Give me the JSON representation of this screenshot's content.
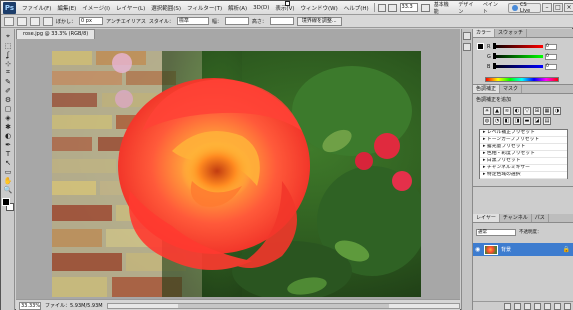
{
  "menubar": {
    "logo": "Ps",
    "items": [
      "ファイル(F)",
      "編集(E)",
      "イメージ(I)",
      "レイヤー(L)",
      "選択範囲(S)",
      "フィルター(T)",
      "解析(A)",
      "3D(D)",
      "表示(V)",
      "ウィンドウ(W)",
      "ヘルプ(H)"
    ],
    "zoom": "33.3",
    "workspace": "基本機能",
    "design": "デザイン",
    "painting": "ペイント",
    "cs_live": "CS Live"
  },
  "options": {
    "feather_label": "ぼかし：",
    "feather_value": "0 px",
    "antialias_label": "アンチエイリアス",
    "style_label": "スタイル：",
    "style_value": "標準",
    "width_label": "幅：",
    "height_label": "高さ：",
    "refine_button": "境界線を調整..."
  },
  "document": {
    "tab_title": "rose.jpg @ 33.3% (RGB/8)",
    "zoom_status": "33.33%",
    "info": "ファイル：5.93M/5.93M"
  },
  "panels": {
    "color_tabs": [
      "カラー",
      "スウォッチ"
    ],
    "color_values": {
      "r": "0",
      "g": "0",
      "b": "0"
    },
    "adjust_tabs": [
      "色調補正",
      "マスク"
    ],
    "adjust_title": "色調補正を追加",
    "adjust_icons": [
      "☀",
      "▲",
      "≋",
      "◐",
      "▽",
      "⊞",
      "▦",
      "◑",
      "◍",
      "◔",
      "◧",
      "◨",
      "▬",
      "◪",
      "▤"
    ],
    "presets": [
      "▸ レベル補正プリセット",
      "▸ トーンカーブプリセット",
      "▸ 露光量プリセット",
      "▸ 色相・彩度プリセット",
      "▸ 白黒プリセット",
      "▸ チャンネルミキサー",
      "▸ 特定色域の選択"
    ],
    "layers_tabs": [
      "レイヤー",
      "チャンネル",
      "パス"
    ],
    "blend_mode": "通常",
    "opacity_label": "不透明度：",
    "layer_name": "背景"
  },
  "tools": [
    "⌖",
    "⬚",
    "ʆ",
    "⊹",
    "⌗",
    "✎",
    "✐",
    "⚙",
    "▢",
    "◈",
    "✱",
    "◐",
    "✒",
    "T",
    "↖",
    "▭",
    "✋",
    "🔍"
  ]
}
